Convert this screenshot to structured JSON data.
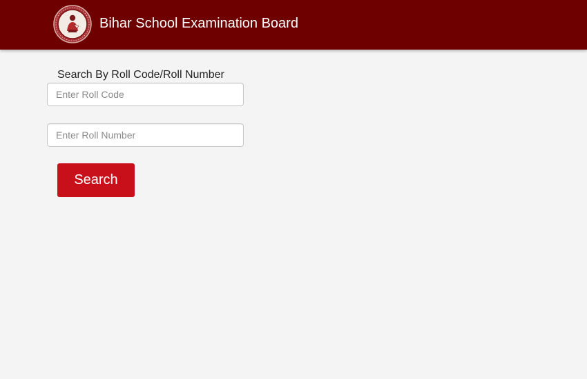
{
  "header": {
    "title": "Bihar School Examination Board",
    "logo_icon": "bseb-emblem-icon",
    "background_color": "#6e0000"
  },
  "form": {
    "heading": "Search By Roll Code/Roll Number",
    "roll_code": {
      "placeholder": "Enter Roll Code",
      "value": ""
    },
    "roll_number": {
      "placeholder": "Enter Roll Number",
      "value": ""
    },
    "search_label": "Search",
    "button_color": "#c8101a"
  }
}
